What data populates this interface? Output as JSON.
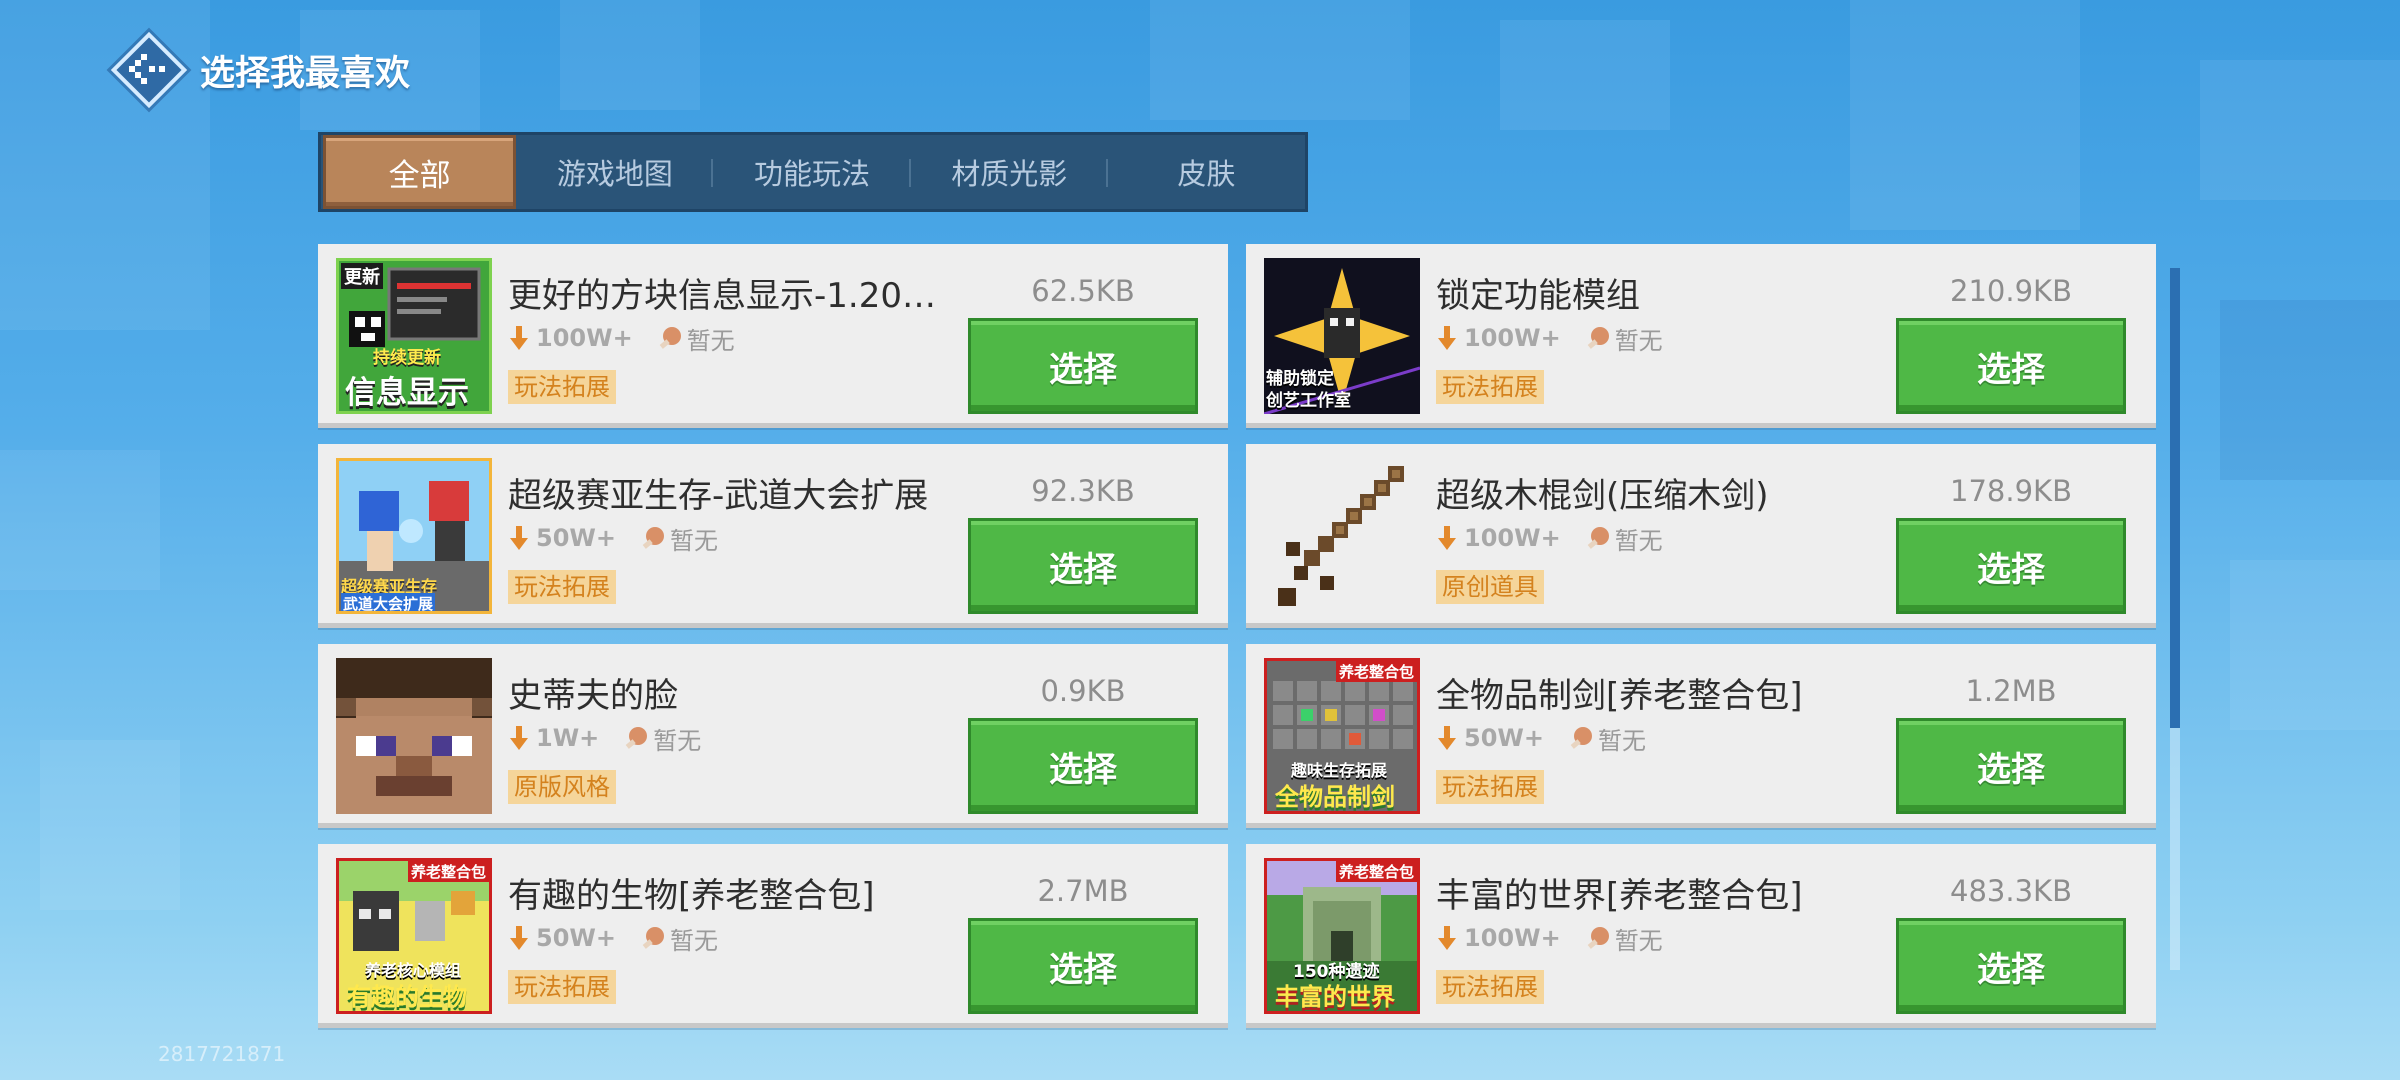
{
  "header": {
    "title": "选择我最喜欢"
  },
  "tabs": [
    {
      "label": "全部",
      "active": true
    },
    {
      "label": "游戏地图",
      "active": false
    },
    {
      "label": "功能玩法",
      "active": false
    },
    {
      "label": "材质光影",
      "active": false
    },
    {
      "label": "皮肤",
      "active": false
    }
  ],
  "items": [
    {
      "name": "更好的方块信息显示-1.20…",
      "downloads": "100W+",
      "rating": "暂无",
      "tag": "玩法拓展",
      "size": "62.5KB",
      "button": "选择",
      "thumb_text": "信息显示",
      "thumb_badge": "更新",
      "thumb_sub": "持续更新"
    },
    {
      "name": "锁定功能模组",
      "downloads": "100W+",
      "rating": "暂无",
      "tag": "玩法拓展",
      "size": "210.9KB",
      "button": "选择",
      "thumb_text": "创艺工作室",
      "thumb_sub": "辅助锁定"
    },
    {
      "name": "超级赛亚生存-武道大会扩展",
      "downloads": "50W+",
      "rating": "暂无",
      "tag": "玩法拓展",
      "size": "92.3KB",
      "button": "选择",
      "thumb_text": "武道大会扩展",
      "thumb_sub": "超级赛亚生存"
    },
    {
      "name": "超级木棍剑(压缩木剑)",
      "downloads": "100W+",
      "rating": "暂无",
      "tag": "原创道具",
      "size": "178.9KB",
      "button": "选择"
    },
    {
      "name": "史蒂夫的脸",
      "downloads": "1W+",
      "rating": "暂无",
      "tag": "原版风格",
      "size": "0.9KB",
      "button": "选择"
    },
    {
      "name": "全物品制剑[养老整合包]",
      "downloads": "50W+",
      "rating": "暂无",
      "tag": "玩法拓展",
      "size": "1.2MB",
      "button": "选择",
      "thumb_badge": "养老整合包",
      "thumb_sub": "趣味生存拓展",
      "thumb_text": "全物品制剑"
    },
    {
      "name": "有趣的生物[养老整合包]",
      "downloads": "50W+",
      "rating": "暂无",
      "tag": "玩法拓展",
      "size": "2.7MB",
      "button": "选择",
      "thumb_badge": "养老整合包",
      "thumb_sub": "养老核心模组",
      "thumb_text": "有趣的生物"
    },
    {
      "name": "丰富的世界[养老整合包]",
      "downloads": "100W+",
      "rating": "暂无",
      "tag": "玩法拓展",
      "size": "483.3KB",
      "button": "选择",
      "thumb_badge": "养老整合包",
      "thumb_sub": "150种遗迹",
      "thumb_text": "丰富的世界"
    }
  ],
  "footer": {
    "uid": "2817721871"
  },
  "colors": {
    "accent_green": "#4fb846",
    "tab_active": "#b9855a",
    "tag_bg": "#f5d59a",
    "tag_text": "#d4821e"
  }
}
